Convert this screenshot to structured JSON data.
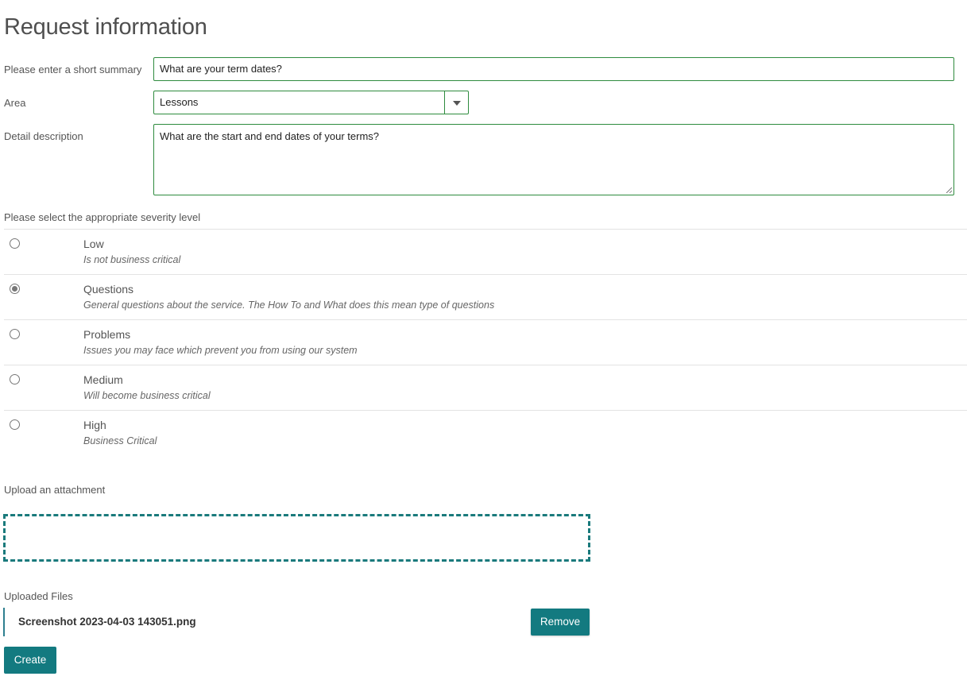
{
  "form": {
    "title": "Request information",
    "summary": {
      "label": "Please enter a short summary",
      "value": "What are your term dates?"
    },
    "area": {
      "label": "Area",
      "selected": "Lessons"
    },
    "detail": {
      "label": "Detail description",
      "value": "What are the start and end dates of your terms?"
    },
    "severity": {
      "label": "Please select the appropriate severity level",
      "selected": "Questions",
      "options": [
        {
          "name": "Low",
          "desc": "Is not business critical"
        },
        {
          "name": "Questions",
          "desc": "General questions about the service. The How To and What does this mean type of questions"
        },
        {
          "name": "Problems",
          "desc": "Issues you may face which prevent you from using our system"
        },
        {
          "name": "Medium",
          "desc": "Will become business critical"
        },
        {
          "name": "High",
          "desc": "Business Critical"
        }
      ]
    },
    "upload": {
      "label": "Upload an attachment"
    },
    "uploaded": {
      "label": "Uploaded Files",
      "files": [
        {
          "name": "Screenshot 2023-04-03 143051.png",
          "remove_label": "Remove"
        }
      ]
    },
    "create_label": "Create"
  },
  "colors": {
    "accent": "#137a80",
    "field_border": "#2e8b3e",
    "text": "#555555"
  }
}
